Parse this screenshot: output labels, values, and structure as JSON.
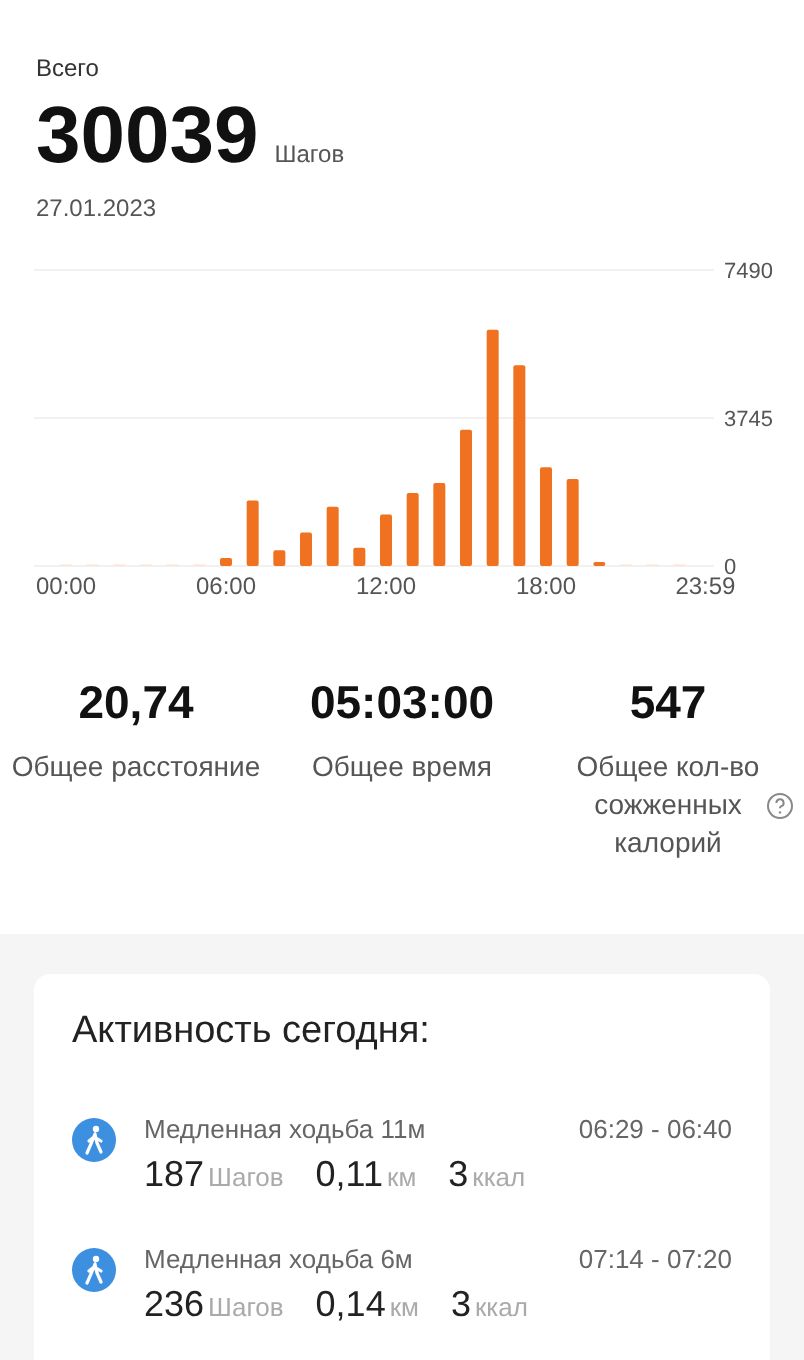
{
  "summary": {
    "label": "Всего",
    "total": "30039",
    "unit": "Шагов",
    "date": "27.01.2023"
  },
  "chart_data": {
    "type": "bar",
    "x": [
      0,
      1,
      2,
      3,
      4,
      5,
      6,
      7,
      8,
      9,
      10,
      11,
      12,
      13,
      14,
      15,
      16,
      17,
      18,
      19,
      20,
      21,
      22,
      23
    ],
    "values": [
      0,
      0,
      0,
      0,
      0,
      0,
      200,
      1660,
      400,
      850,
      1500,
      460,
      1300,
      1850,
      2100,
      3450,
      5980,
      5080,
      2500,
      2200,
      100,
      0,
      0,
      0
    ],
    "xlim": [
      -1.2,
      24.3
    ],
    "ylim": [
      0,
      7490
    ],
    "xticks": [
      {
        "value": 0,
        "label": "00:00"
      },
      {
        "value": 6,
        "label": "06:00"
      },
      {
        "value": 12,
        "label": "12:00"
      },
      {
        "value": 18,
        "label": "18:00"
      },
      {
        "value": 23.98,
        "label": "23:59"
      }
    ],
    "yticks": [
      0,
      3745,
      7490
    ]
  },
  "stats": [
    {
      "value": "20,74",
      "label": "Общее расстояние",
      "help": false
    },
    {
      "value": "05:03:00",
      "label": "Общее время",
      "help": false
    },
    {
      "value": "547",
      "label": "Общее кол-во сожженных калорий",
      "help": true
    }
  ],
  "activity": {
    "title": "Активность сегодня:",
    "items": [
      {
        "name": "Медленная ходьба 11м",
        "time": "06:29 - 06:40",
        "metrics": [
          {
            "value": "187",
            "unit": "Шагов"
          },
          {
            "value": "0,11",
            "unit": "км"
          },
          {
            "value": "3",
            "unit": "ккал"
          }
        ]
      },
      {
        "name": "Медленная ходьба 6м",
        "time": "07:14 - 07:20",
        "metrics": [
          {
            "value": "236",
            "unit": "Шагов"
          },
          {
            "value": "0,14",
            "unit": "км"
          },
          {
            "value": "3",
            "unit": "ккал"
          }
        ]
      }
    ]
  }
}
